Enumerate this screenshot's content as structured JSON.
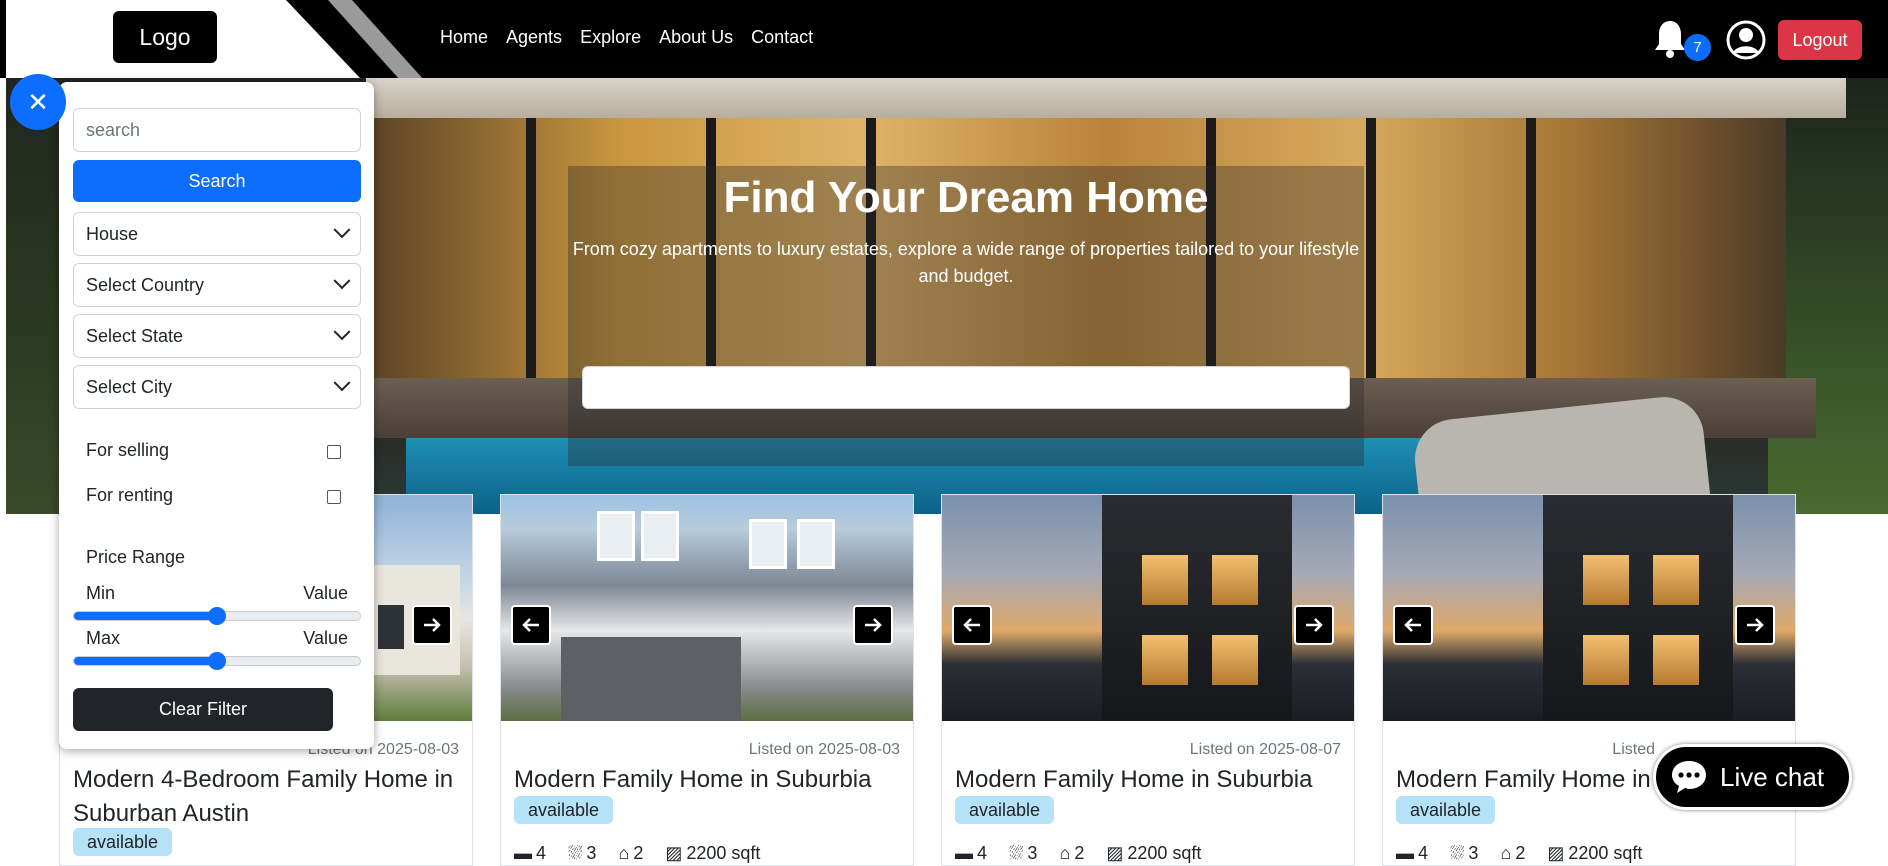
{
  "navbar": {
    "logo_text": "Logo",
    "links": [
      "Home",
      "Agents",
      "Explore",
      "About Us",
      "Contact"
    ],
    "notification_count": "7",
    "logout_label": "Logout"
  },
  "hero": {
    "title": "Find Your Dream Home",
    "subtitle": "From cozy apartments to luxury estates, explore a wide range of properties tailored to your lifestyle and budget."
  },
  "filter": {
    "search_placeholder": "search",
    "search_button": "Search",
    "property_type": "House",
    "country_placeholder": "Select Country",
    "state_placeholder": "Select State",
    "city_placeholder": "Select City",
    "for_selling_label": "For selling",
    "for_renting_label": "For renting",
    "price_range_label": "Price Range",
    "min_label": "Min",
    "max_label": "Max",
    "value_label": "Value",
    "min_slider_level": 0.5,
    "max_slider_level": 0.5,
    "clear_button": "Clear Filter"
  },
  "cards": [
    {
      "listed": "Listed on 2025-08-03",
      "title": "Modern 4-Bedroom Family Home in Suburban Austin",
      "status": "available"
    },
    {
      "listed": "Listed on 2025-08-03",
      "title": "Modern Family Home in Suburbia",
      "status": "available",
      "beds": "4",
      "baths": "3",
      "garage": "2",
      "area": "2200 sqft"
    },
    {
      "listed": "Listed on 2025-08-07",
      "title": "Modern Family Home in Suburbia",
      "status": "available",
      "beds": "4",
      "baths": "3",
      "garage": "2",
      "area": "2200 sqft"
    },
    {
      "listed": "Listed",
      "title": "Modern Family Home in S",
      "status": "available",
      "beds": "4",
      "baths": "3",
      "garage": "2",
      "area": "2200 sqft"
    }
  ],
  "live_chat": {
    "label": "Live chat"
  },
  "colors": {
    "primary": "#0d6efd",
    "danger": "#dc3545",
    "dark": "#212529",
    "badge": "#b6e2f7"
  }
}
